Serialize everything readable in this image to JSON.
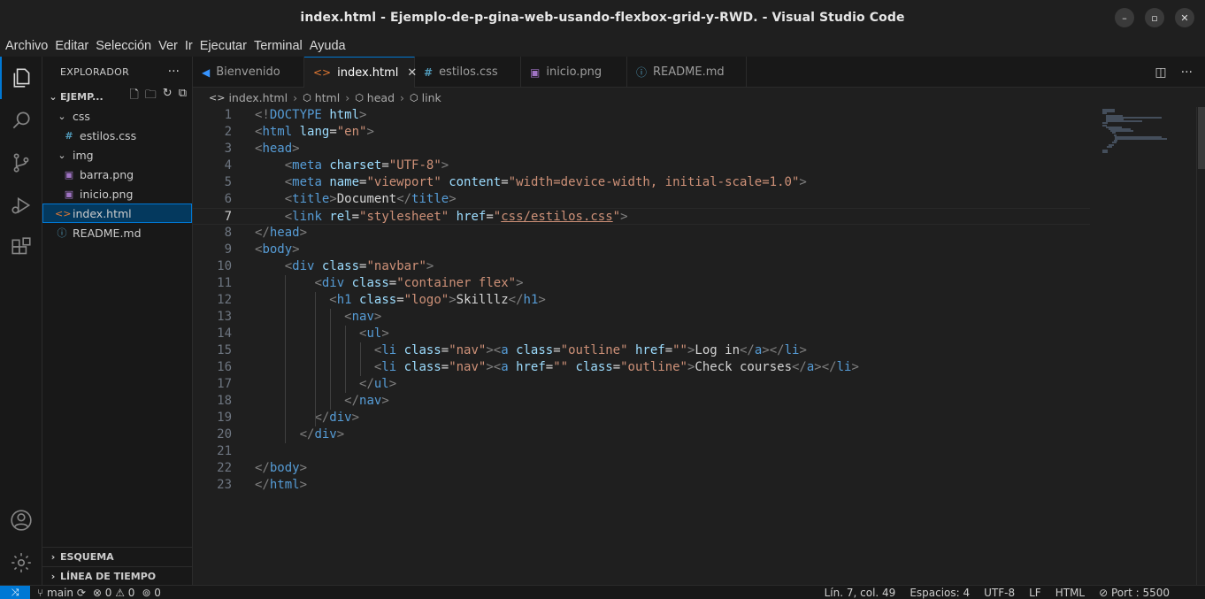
{
  "window": {
    "title": "index.html - Ejemplo-de-p-gina-web-usando-flexbox-grid-y-RWD. - Visual Studio Code",
    "minimize": "–",
    "maximize": "▫",
    "close": "✕"
  },
  "menu": [
    "Archivo",
    "Editar",
    "Selección",
    "Ver",
    "Ir",
    "Ejecutar",
    "Terminal",
    "Ayuda"
  ],
  "sidebar": {
    "header": "EXPLORADOR",
    "more": "···",
    "folder": "EJEMP...",
    "tree": [
      {
        "label": "css",
        "kind": "folder",
        "icon": "⌄"
      },
      {
        "label": "estilos.css",
        "kind": "css",
        "icon": "#"
      },
      {
        "label": "img",
        "kind": "folder",
        "icon": "⌄"
      },
      {
        "label": "barra.png",
        "kind": "image",
        "icon": "▣"
      },
      {
        "label": "inicio.png",
        "kind": "image",
        "icon": "▣"
      },
      {
        "label": "index.html",
        "kind": "html",
        "icon": "<>"
      },
      {
        "label": "README.md",
        "kind": "info",
        "icon": "ⓘ"
      }
    ],
    "outline": "ESQUEMA",
    "timeline": "LÍNEA DE TIEMPO"
  },
  "tabs": [
    {
      "label": "Bienvenido",
      "icon": "◀",
      "active": false
    },
    {
      "label": "index.html",
      "icon": "<>",
      "active": true,
      "close": "✕"
    },
    {
      "label": "estilos.css",
      "icon": "#",
      "active": false
    },
    {
      "label": "inicio.png",
      "icon": "▣",
      "active": false
    },
    {
      "label": "README.md",
      "icon": "ⓘ",
      "active": false
    }
  ],
  "breadcrumb": [
    "index.html",
    "html",
    "head",
    "link"
  ],
  "code": {
    "current_line": 7,
    "lines": [
      [
        [
          "br",
          "<!"
        ],
        [
          "tag",
          "DOCTYPE"
        ],
        [
          "txt",
          " "
        ],
        [
          "attr",
          "html"
        ],
        [
          "br",
          ">"
        ]
      ],
      [
        [
          "br",
          "<"
        ],
        [
          "tag",
          "html"
        ],
        [
          "txt",
          " "
        ],
        [
          "attr",
          "lang"
        ],
        [
          "txt",
          "="
        ],
        [
          "str",
          "\"en\""
        ],
        [
          "br",
          ">"
        ]
      ],
      [
        [
          "br",
          "<"
        ],
        [
          "tag",
          "head"
        ],
        [
          "br",
          ">"
        ]
      ],
      [
        [
          "txt",
          "    "
        ],
        [
          "br",
          "<"
        ],
        [
          "tag",
          "meta"
        ],
        [
          "txt",
          " "
        ],
        [
          "attr",
          "charset"
        ],
        [
          "txt",
          "="
        ],
        [
          "str",
          "\"UTF-8\""
        ],
        [
          "br",
          ">"
        ]
      ],
      [
        [
          "txt",
          "    "
        ],
        [
          "br",
          "<"
        ],
        [
          "tag",
          "meta"
        ],
        [
          "txt",
          " "
        ],
        [
          "attr",
          "name"
        ],
        [
          "txt",
          "="
        ],
        [
          "str",
          "\"viewport\""
        ],
        [
          "txt",
          " "
        ],
        [
          "attr",
          "content"
        ],
        [
          "txt",
          "="
        ],
        [
          "str",
          "\"width=device-width, initial-scale=1.0\""
        ],
        [
          "br",
          ">"
        ]
      ],
      [
        [
          "txt",
          "    "
        ],
        [
          "br",
          "<"
        ],
        [
          "tag",
          "title"
        ],
        [
          "br",
          ">"
        ],
        [
          "txt",
          "Document"
        ],
        [
          "br",
          "</"
        ],
        [
          "tag",
          "title"
        ],
        [
          "br",
          ">"
        ]
      ],
      [
        [
          "txt",
          "    "
        ],
        [
          "br",
          "<"
        ],
        [
          "tag",
          "link"
        ],
        [
          "txt",
          " "
        ],
        [
          "attr",
          "rel"
        ],
        [
          "txt",
          "="
        ],
        [
          "str",
          "\"stylesheet\""
        ],
        [
          "txt",
          " "
        ],
        [
          "attr",
          "href"
        ],
        [
          "txt",
          "="
        ],
        [
          "str",
          "\""
        ],
        [
          "strul",
          "css/estilos.css"
        ],
        [
          "str",
          "\""
        ],
        [
          "br",
          ">"
        ]
      ],
      [
        [
          "br",
          "</"
        ],
        [
          "tag",
          "head"
        ],
        [
          "br",
          ">"
        ]
      ],
      [
        [
          "br",
          "<"
        ],
        [
          "tag",
          "body"
        ],
        [
          "br",
          ">"
        ]
      ],
      [
        [
          "txt",
          "    "
        ],
        [
          "br",
          "<"
        ],
        [
          "tag",
          "div"
        ],
        [
          "txt",
          " "
        ],
        [
          "attr",
          "class"
        ],
        [
          "txt",
          "="
        ],
        [
          "str",
          "\"navbar\""
        ],
        [
          "br",
          ">"
        ]
      ],
      [
        [
          "txt",
          "        "
        ],
        [
          "br",
          "<"
        ],
        [
          "tag",
          "div"
        ],
        [
          "txt",
          " "
        ],
        [
          "attr",
          "class"
        ],
        [
          "txt",
          "="
        ],
        [
          "str",
          "\"container flex\""
        ],
        [
          "br",
          ">"
        ]
      ],
      [
        [
          "txt",
          "          "
        ],
        [
          "br",
          "<"
        ],
        [
          "tag",
          "h1"
        ],
        [
          "txt",
          " "
        ],
        [
          "attr",
          "class"
        ],
        [
          "txt",
          "="
        ],
        [
          "str",
          "\"logo\""
        ],
        [
          "br",
          ">"
        ],
        [
          "txt",
          "Skilllz"
        ],
        [
          "br",
          "</"
        ],
        [
          "tag",
          "h1"
        ],
        [
          "br",
          ">"
        ]
      ],
      [
        [
          "txt",
          "            "
        ],
        [
          "br",
          "<"
        ],
        [
          "tag",
          "nav"
        ],
        [
          "br",
          ">"
        ]
      ],
      [
        [
          "txt",
          "              "
        ],
        [
          "br",
          "<"
        ],
        [
          "tag",
          "ul"
        ],
        [
          "br",
          ">"
        ]
      ],
      [
        [
          "txt",
          "                "
        ],
        [
          "br",
          "<"
        ],
        [
          "tag",
          "li"
        ],
        [
          "txt",
          " "
        ],
        [
          "attr",
          "class"
        ],
        [
          "txt",
          "="
        ],
        [
          "str",
          "\"nav\""
        ],
        [
          "br",
          "><"
        ],
        [
          "tag",
          "a"
        ],
        [
          "txt",
          " "
        ],
        [
          "attr",
          "class"
        ],
        [
          "txt",
          "="
        ],
        [
          "str",
          "\"outline\""
        ],
        [
          "txt",
          " "
        ],
        [
          "attr",
          "href"
        ],
        [
          "txt",
          "="
        ],
        [
          "str",
          "\"\""
        ],
        [
          "br",
          ">"
        ],
        [
          "txt",
          "Log in"
        ],
        [
          "br",
          "</"
        ],
        [
          "tag",
          "a"
        ],
        [
          "br",
          "></"
        ],
        [
          "tag",
          "li"
        ],
        [
          "br",
          ">"
        ]
      ],
      [
        [
          "txt",
          "                "
        ],
        [
          "br",
          "<"
        ],
        [
          "tag",
          "li"
        ],
        [
          "txt",
          " "
        ],
        [
          "attr",
          "class"
        ],
        [
          "txt",
          "="
        ],
        [
          "str",
          "\"nav\""
        ],
        [
          "br",
          "><"
        ],
        [
          "tag",
          "a"
        ],
        [
          "txt",
          " "
        ],
        [
          "attr",
          "href"
        ],
        [
          "txt",
          "="
        ],
        [
          "str",
          "\"\""
        ],
        [
          "txt",
          " "
        ],
        [
          "attr",
          "class"
        ],
        [
          "txt",
          "="
        ],
        [
          "str",
          "\"outline\""
        ],
        [
          "br",
          ">"
        ],
        [
          "txt",
          "Check courses"
        ],
        [
          "br",
          "</"
        ],
        [
          "tag",
          "a"
        ],
        [
          "br",
          "></"
        ],
        [
          "tag",
          "li"
        ],
        [
          "br",
          ">"
        ]
      ],
      [
        [
          "txt",
          "              "
        ],
        [
          "br",
          "</"
        ],
        [
          "tag",
          "ul"
        ],
        [
          "br",
          ">"
        ]
      ],
      [
        [
          "txt",
          "            "
        ],
        [
          "br",
          "</"
        ],
        [
          "tag",
          "nav"
        ],
        [
          "br",
          ">"
        ]
      ],
      [
        [
          "txt",
          "        "
        ],
        [
          "br",
          "</"
        ],
        [
          "tag",
          "div"
        ],
        [
          "br",
          ">"
        ]
      ],
      [
        [
          "txt",
          "      "
        ],
        [
          "br",
          "</"
        ],
        [
          "tag",
          "div"
        ],
        [
          "br",
          ">"
        ]
      ],
      [],
      [
        [
          "br",
          "</"
        ],
        [
          "tag",
          "body"
        ],
        [
          "br",
          ">"
        ]
      ],
      [
        [
          "br",
          "</"
        ],
        [
          "tag",
          "html"
        ],
        [
          "br",
          ">"
        ]
      ]
    ]
  },
  "status": {
    "branch": "main",
    "sync": "⟳",
    "problems": "⊗ 0 ⚠ 0",
    "ports": "⊚ 0",
    "position": "Lín. 7, col. 49",
    "spaces": "Espacios: 4",
    "encoding": "UTF-8",
    "eol": "LF",
    "language": "HTML",
    "port": "⊘ Port : 5500"
  },
  "colors": {
    "accent": "#0078d4",
    "tag": "#569cd6",
    "attr": "#9cdcfe",
    "string": "#ce9178"
  }
}
